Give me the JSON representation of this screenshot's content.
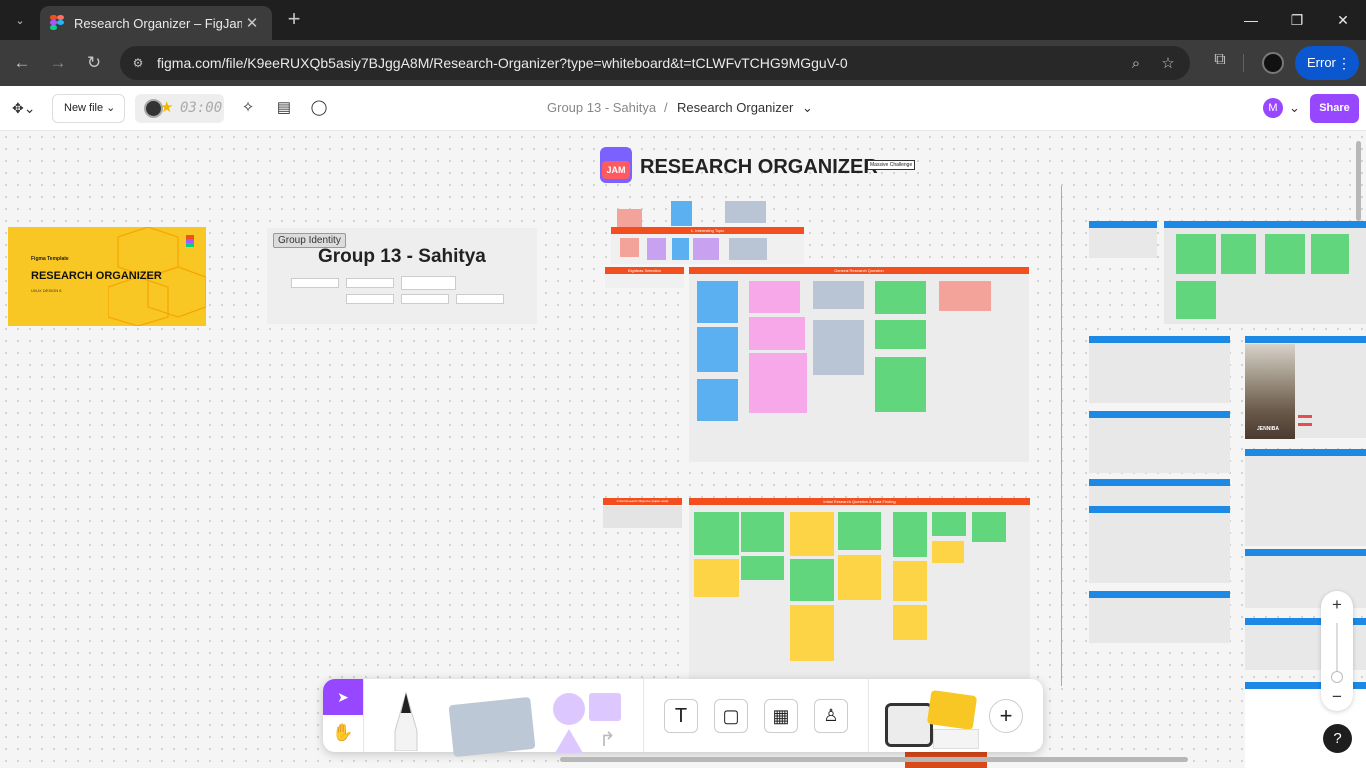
{
  "browser": {
    "tab_title": "Research Organizer – FigJam",
    "url_host": "figma.com",
    "url_path": "/file/K9eeRUXQb5asiy7BJggA8M/Research-Organizer?type=whiteboard&t=tCLWFvTCHG9MGguV-0",
    "error_label": "Error"
  },
  "toolbar": {
    "new_file_label": "New file",
    "timer": "03:00",
    "breadcrumb_team": "Group 13 - Sahitya",
    "breadcrumb_sep": "/",
    "breadcrumb_file": "Research Organizer",
    "avatar_initial": "M",
    "share_label": "Share"
  },
  "canvas": {
    "main_title": "RESEARCH ORGANIZER",
    "main_badge": "Massive Challenge",
    "jam_logo": "JAM",
    "template_card": {
      "label": "Figma Template",
      "title": "RESEARCH ORGANIZER",
      "subtitle": "UI/UX DESIGN 6"
    },
    "group_identity": {
      "label": "Group Identity",
      "title": "Group 13 - Sahitya"
    },
    "section_headers": {
      "interesting_topic": "1. Interesting Topic",
      "bigideas": "Bigideas Selection",
      "general_rq": "General Research Question",
      "initial_rq": "Initial Research Objective (kajian awal)",
      "initial_rq_data": "Initial Research Question & Data Finding",
      "persona_name": "JENNIBA"
    }
  },
  "bottom_toolbar": {
    "tools": [
      "move-tool",
      "hand-tool",
      "pen-tool",
      "sticky-note-tool",
      "shapes-tool",
      "text-tool",
      "section-tool",
      "table-tool",
      "stamp-tool",
      "widgets",
      "add-tool"
    ]
  },
  "zoom": {
    "plus": "+",
    "minus": "−"
  },
  "help_label": "?"
}
